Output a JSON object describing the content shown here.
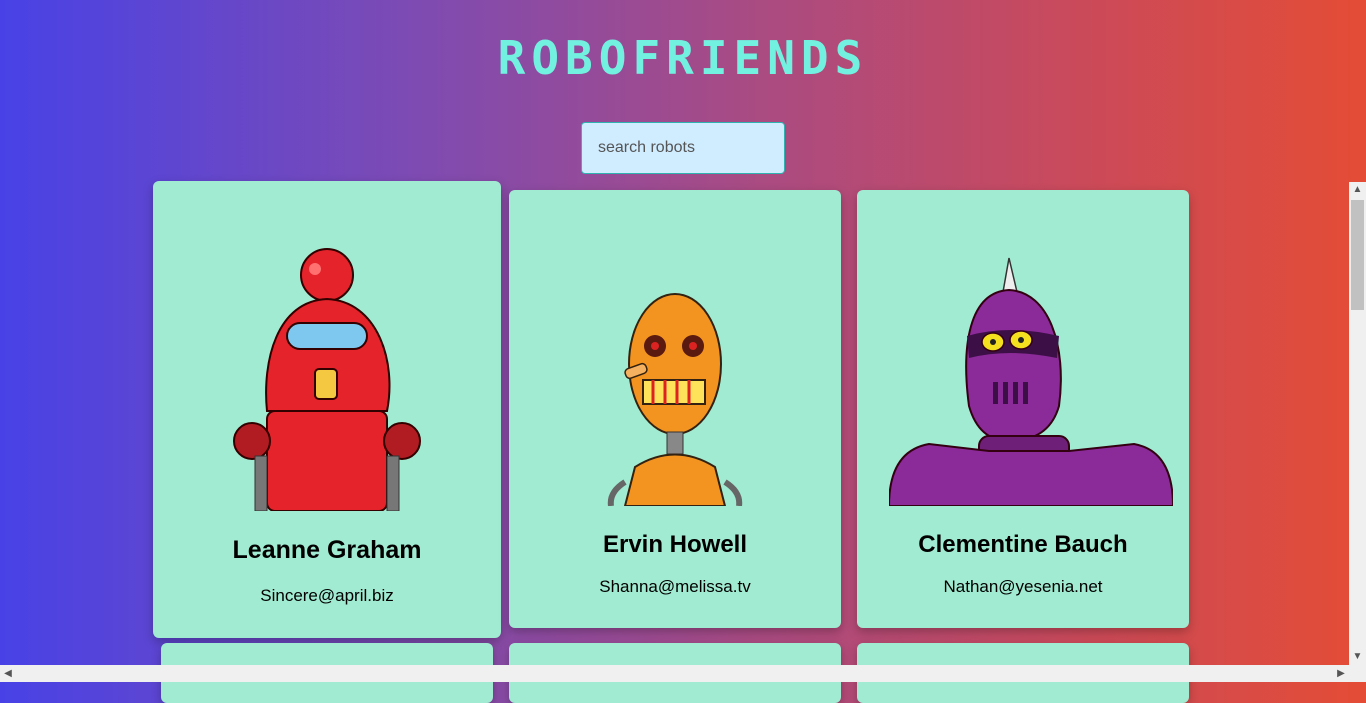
{
  "header": {
    "title": "ROBOFRIENDS"
  },
  "search": {
    "placeholder": "search robots",
    "value": ""
  },
  "robots": [
    {
      "name": "Leanne Graham",
      "email": "Sincere@april.biz",
      "color": "#e4232b"
    },
    {
      "name": "Ervin Howell",
      "email": "Shanna@melissa.tv",
      "color": "#f39320"
    },
    {
      "name": "Clementine Bauch",
      "email": "Nathan@yesenia.net",
      "color": "#8b2a99"
    }
  ],
  "colors": {
    "card": "#a0ebd2",
    "title": "#73f1e0",
    "search_bg": "#d0ecff"
  }
}
